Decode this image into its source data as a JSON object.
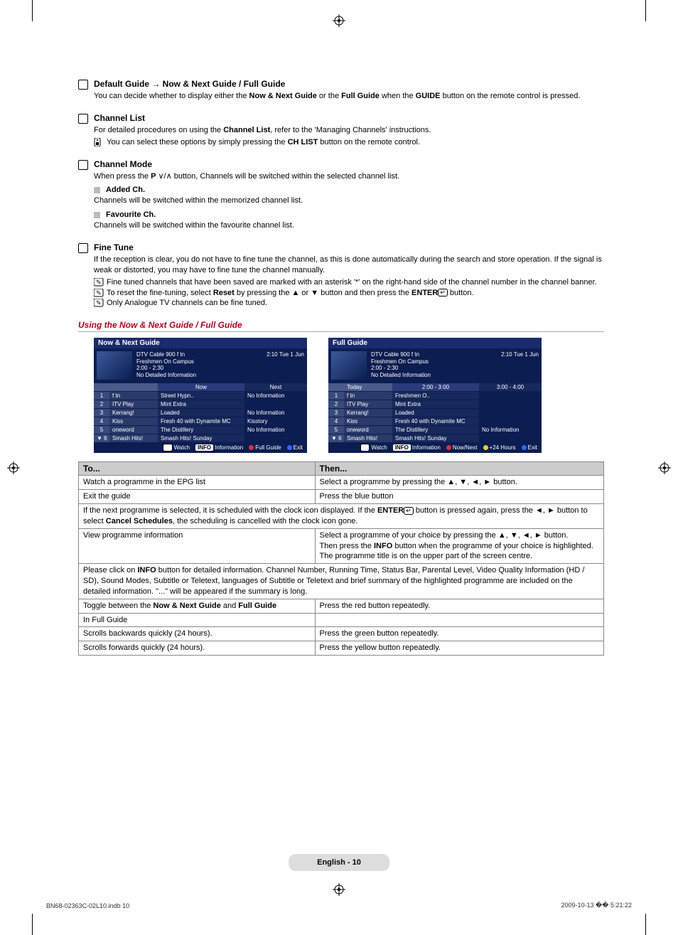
{
  "s1": {
    "title": "Default Guide → Now & Next Guide / Full Guide",
    "p1a": "You can decide whether to display either the ",
    "p1b": "Now & Next Guide",
    "p1c": " or the ",
    "p1d": "Full Guide",
    "p1e": " when the ",
    "p1f": "GUIDE",
    "p1g": " button on the remote control is pressed."
  },
  "s2": {
    "title": "Channel List",
    "p1a": "For detailed procedures on using the ",
    "p1b": "Channel List",
    "p1c": ", refer to the 'Managing Channels' instructions.",
    "n1a": "You can select these options by simply pressing the ",
    "n1b": "CH LIST",
    "n1c": " button on the remote control."
  },
  "s3": {
    "title": "Channel Mode",
    "p1a": "When press the ",
    "p1b": "P",
    "p1c": " ∨/∧ button, Channels will be switched within the selected channel list.",
    "sub1t": "Added Ch.",
    "sub1p": "Channels will be switched within the memorized channel list.",
    "sub2t": "Favourite Ch.",
    "sub2p": "Channels will be switched within the favourite channel list."
  },
  "s4": {
    "title": "Fine Tune",
    "p1": "If the reception is clear, you do not have to fine tune the channel, as this is done automatically during the search and store operation. If the signal is weak or distorted, you may have to fine tune the channel manually.",
    "n1": "Fine tuned channels that have been saved are marked with an asterisk '*' on the right-hand side of the channel number in the channel banner.",
    "n2a": "To reset the fine-tuning, select ",
    "n2b": "Reset",
    "n2c": " by pressing the ▲ or ▼ button and then press the ",
    "n2d": "ENTER",
    "n2e": " button.",
    "n3": "Only Analogue TV channels can be fine tuned."
  },
  "using": "Using the Now & Next Guide / Full Guide",
  "shotA": {
    "title": "Now & Next Guide",
    "cable": "DTV Cable 900 f tn",
    "prog": "Freshmen On Campus",
    "time": "2:00 - 2:30",
    "nd": "No Detailed Information",
    "clock": "2:10  Tue 1 Jun",
    "hA": "Now",
    "hB": "Next",
    "rows": [
      {
        "i": "1",
        "ch": "f tn",
        "a": "Street Hypn..",
        "b": "No Information"
      },
      {
        "i": "2",
        "ch": "ITV Play",
        "a": "Mint Extra",
        "b": ""
      },
      {
        "i": "3",
        "ch": "Kerrang!",
        "a": "Loaded",
        "b": "No Information"
      },
      {
        "i": "4",
        "ch": "Kiss",
        "a": "Fresh 40 with Dynamite MC",
        "b": "Kisstory"
      },
      {
        "i": "5",
        "ch": "oneword",
        "a": "The Distillery",
        "b": "No Information"
      },
      {
        "i": "▼ 6",
        "ch": "Smash Hits!",
        "a": "Smash Hits! Sunday",
        "b": ""
      }
    ],
    "f": {
      "watch": "Watch",
      "info": "Information",
      "full": "Full Guide",
      "exit": "Exit"
    }
  },
  "shotB": {
    "title": "Full Guide",
    "cable": "DTV Cable 900 f tn",
    "prog": "Freshmen On Campus",
    "time": "2:00 - 2:30",
    "nd": "No Detailed Information",
    "clock": "2:10  Tue 1 Jun",
    "hDay": "Today",
    "hA": "2:00 - 3:00",
    "hB": "3:00 - 4:00",
    "rows": [
      {
        "i": "1",
        "ch": "f tn",
        "a": "Freshmen O..",
        "b": ""
      },
      {
        "i": "2",
        "ch": "ITV Play",
        "a": "Mint Extra",
        "b": ""
      },
      {
        "i": "3",
        "ch": "Kerrang!",
        "a": "Loaded",
        "b": ""
      },
      {
        "i": "4",
        "ch": "Kiss",
        "a": "Fresh 40 with Dynamite MC",
        "b": ""
      },
      {
        "i": "5",
        "ch": "oneword",
        "a": "The Distillery",
        "b": "No Information"
      },
      {
        "i": "▼ 6",
        "ch": "Smash Hits!",
        "a": "Smash Hits! Sunday",
        "b": ""
      }
    ],
    "f": {
      "watch": "Watch",
      "info": "Information",
      "nn": "Now/Next",
      "p24": "+24 Hours",
      "exit": "Exit"
    }
  },
  "tbl": {
    "hTo": "To...",
    "hThen": "Then...",
    "r1to": "Watch a programme in the EPG list",
    "r1then": "Select a programme by pressing the ▲, ▼, ◄, ► button.",
    "r2to": "Exit the guide",
    "r2then": "Press the blue button",
    "r3a": "If the next programme is selected, it is scheduled with the clock icon displayed. If the ",
    "r3b": "ENTER",
    "r3c": " button is pressed again, press the ◄, ► button to select ",
    "r3d": "Cancel Schedules",
    "r3e": ", the scheduling is cancelled with the clock icon gone.",
    "r4to": "View programme information",
    "r4then1": "Select a programme of your choice by pressing the ▲, ▼, ◄, ► button.",
    "r4then2a": "Then press the ",
    "r4then2b": "INFO",
    "r4then2c": " button when the programme of your choice is highlighted.",
    "r4then3": "The programme title is on the upper part of the screen centre.",
    "r5a": "Please click on ",
    "r5b": "INFO",
    "r5c": " button for detailed information. Channel Number, Running Time, Status Bar, Parental Level, Video Quality Information (HD / SD), Sound Modes, Subtitle or Teletext, languages of Subtitle or Teletext and brief summary of the highlighted programme are included on the detailed information. \"...\" will be appeared if the summary is long.",
    "r6to_a": "Toggle between the ",
    "r6to_b": "Now & Next Guide",
    "r6to_c": " and ",
    "r6to_d": "Full Guide",
    "r6then": "Press the red button repeatedly.",
    "r7to": "In Full Guide",
    "r8to": "Scrolls backwards quickly (24 hours).",
    "r8then": "Press the green button repeatedly.",
    "r9to": "Scrolls forwards quickly (24 hours).",
    "r9then": "Press the yellow button repeatedly."
  },
  "footer": {
    "page": "English - 10",
    "left": "BN68-02363C-02L10.indb   10",
    "right": "2009-10-13   �� 5:21:22"
  }
}
